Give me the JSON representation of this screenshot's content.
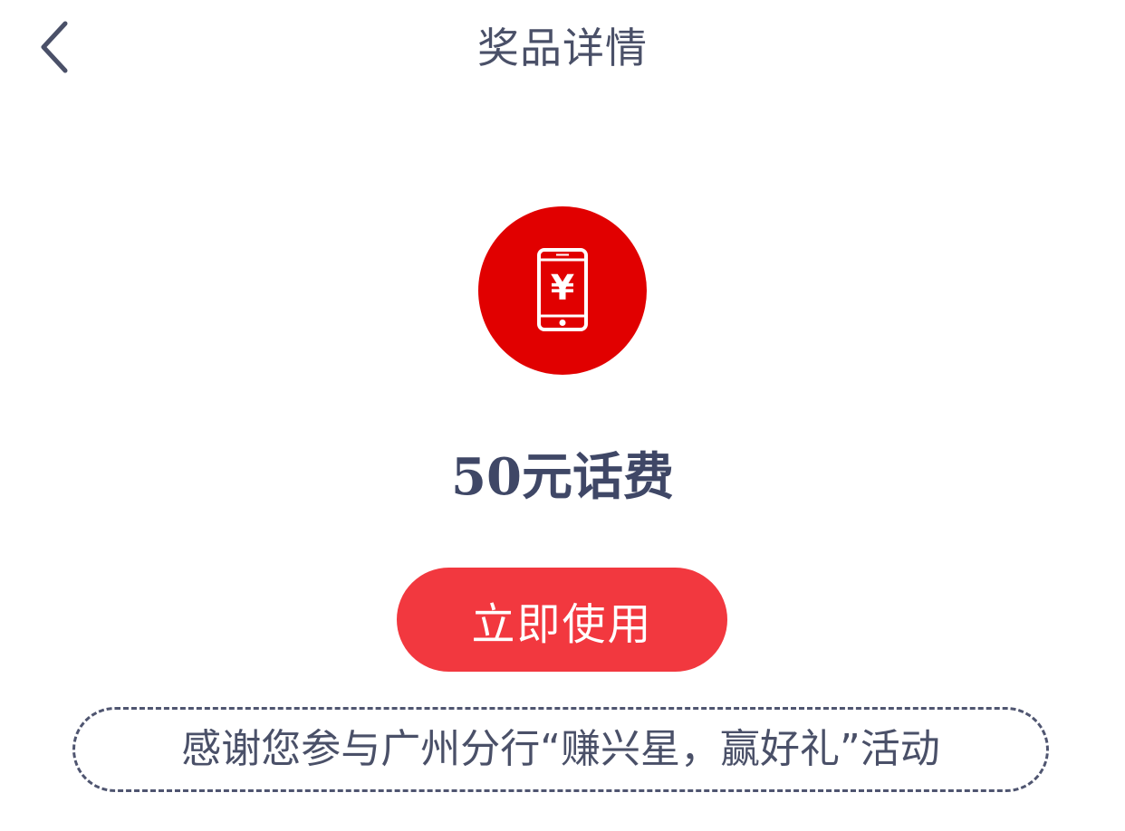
{
  "nav": {
    "title": "奖品详情",
    "back_icon": "chevron-left-icon"
  },
  "prize": {
    "icon": "mobile-phone-yuan-icon",
    "icon_glyph": "¥",
    "name": "50元话费"
  },
  "actions": {
    "use_label": "立即使用"
  },
  "footer": {
    "thanks_text": "感谢您参与广州分行“赚兴星，赢好礼”活动"
  },
  "colors": {
    "background": "#ffffff",
    "title_text": "#4a5068",
    "icon_circle": "#e10000",
    "button_bg": "#f2383f",
    "button_text": "#ffffff",
    "prize_name_text": "#3f4766",
    "footer_text": "#4a5068",
    "dashed_border": "#4f5570"
  }
}
